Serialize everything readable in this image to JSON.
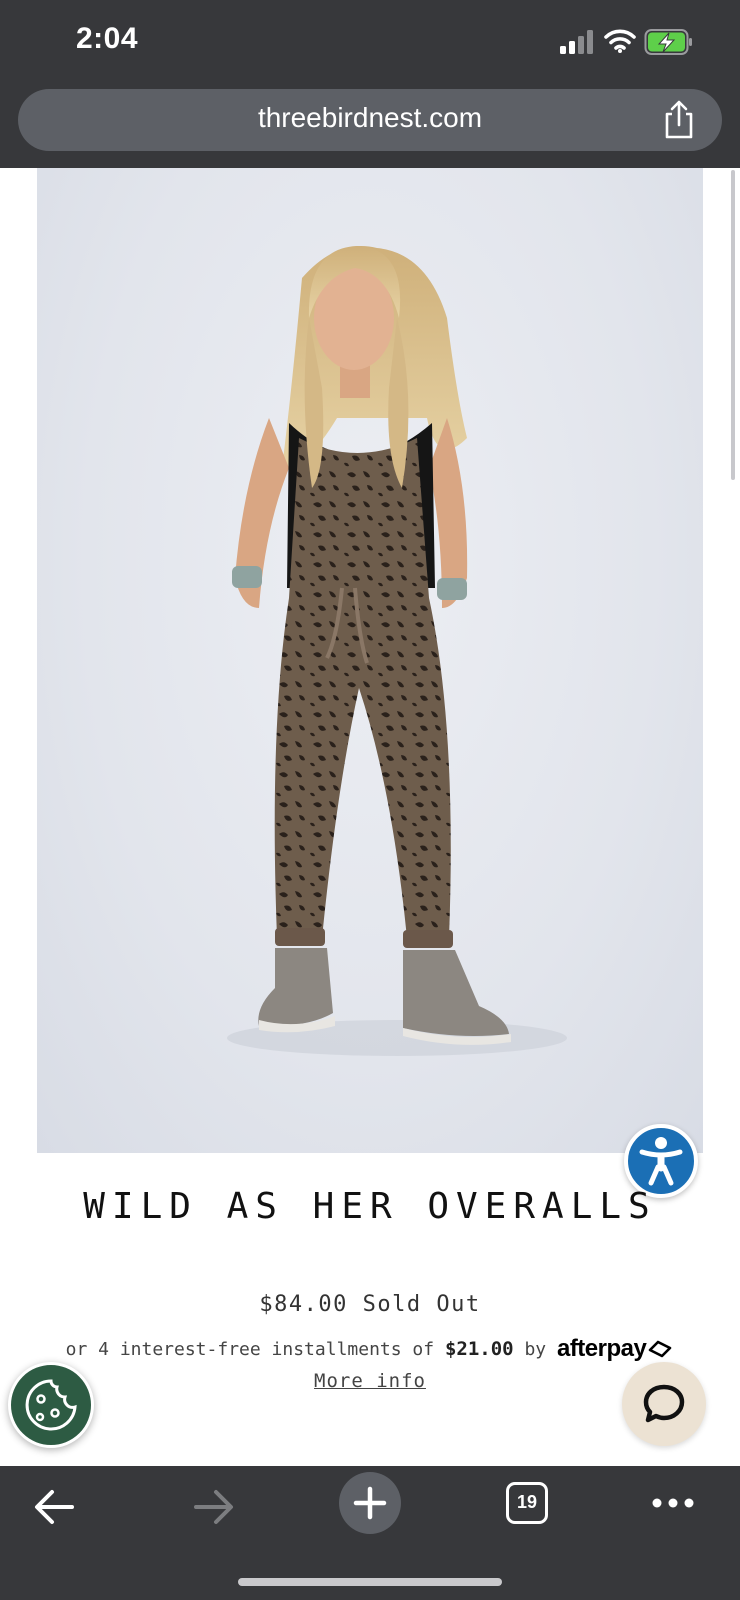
{
  "status_bar": {
    "time": "2:04",
    "signal_icon": "cellular-signal-icon",
    "wifi_icon": "wifi-icon",
    "battery_icon": "battery-charging-icon",
    "battery_color": "#5ecf4a"
  },
  "browser": {
    "url": "threebirdnest.com",
    "share_icon": "share-icon",
    "back_icon": "arrow-left-icon",
    "forward_icon": "arrow-right-icon",
    "new_tab_icon": "plus-icon",
    "tab_count": "19",
    "menu_icon": "more-horizontal-icon"
  },
  "product": {
    "image_subject": "model-in-leopard-overalls-photo",
    "title": "WILD AS HER OVERALLS",
    "price_status": "$84.00 Sold Out",
    "installments_prefix": "or 4 interest-free installments of",
    "installment_amount": "$21.00",
    "installments_by": "by",
    "afterpay_brand": "afterpay",
    "more_info": "More info"
  },
  "floating": {
    "accessibility_icon": "accessibility-icon",
    "accessibility_color": "#1b6fb5",
    "cookie_icon": "cookie-icon",
    "cookie_color": "#2d5b43",
    "chat_icon": "chat-bubble-icon",
    "chat_color": "#ece2d3"
  }
}
